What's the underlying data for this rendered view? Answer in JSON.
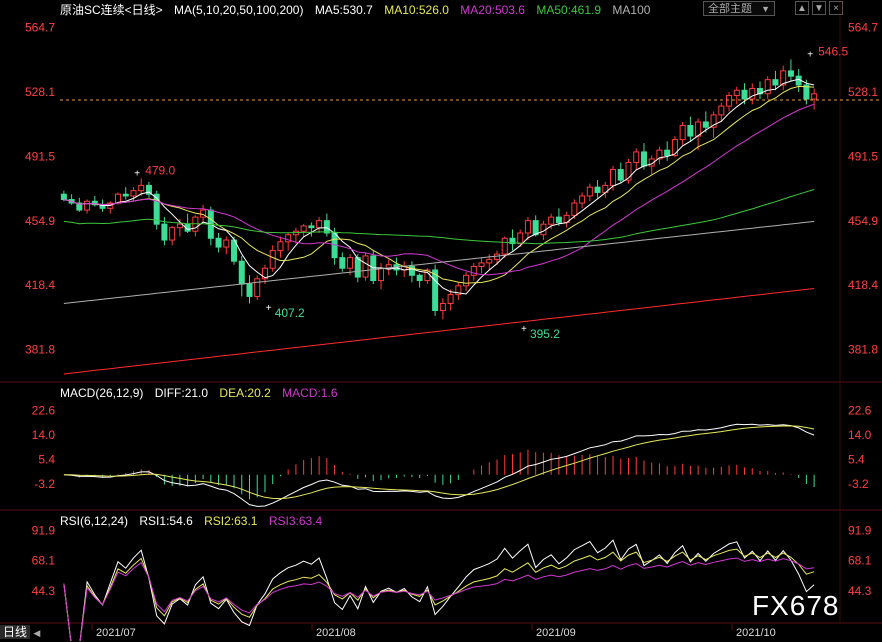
{
  "header": {
    "instrument": "原油SC连续",
    "period": "<日线>",
    "ma_params": "MA(5,10,20,50,100,200)",
    "ma5": "MA5:530.7",
    "ma10": "MA10:526.0",
    "ma20": "MA20:503.6",
    "ma50": "MA50:461.9",
    "ma100": "MA100"
  },
  "controls": {
    "theme_select": "全部主题",
    "btn1": "▲",
    "btn2": "▼",
    "btn3": "×"
  },
  "macd_header": {
    "params": "MACD(26,12,9)",
    "diff": "DIFF:21.0",
    "dea": "DEA:20.2",
    "macd": "MACD:1.6"
  },
  "rsi_header": {
    "params": "RSI(6,12,24)",
    "rsi1": "RSI1:54.6",
    "rsi2": "RSI2:63.1",
    "rsi3": "RSI3:63.4"
  },
  "bottom_left": "日线",
  "watermark": "FX678",
  "colors": {
    "up": "#ff3b3b",
    "down": "#3ddc97",
    "ma5": "#ffffff",
    "ma10": "#e8e85a",
    "ma20": "#d238d2",
    "ma50": "#3cc83c",
    "ma100": "#b0b0b0",
    "ma200": "#ff2a2a",
    "axis": "#ff4040"
  },
  "chart_data": [
    {
      "type": "candlestick",
      "y_ticks": [
        "564.7",
        "528.1",
        "491.5",
        "454.9",
        "418.4",
        "381.8"
      ],
      "x_ticks": [
        "2021/07",
        "2021/08",
        "2021/09",
        "2021/10"
      ],
      "ylim": [
        364,
        570
      ],
      "last_price_line": 523.5,
      "annotations": [
        {
          "label": "479.0",
          "index": 10,
          "value": 479.0,
          "kind": "high"
        },
        {
          "label": "407.2",
          "index": 27,
          "value": 407.2,
          "kind": "low"
        },
        {
          "label": "395.2",
          "index": 60,
          "value": 395.2,
          "kind": "low"
        },
        {
          "label": "546.5",
          "index": 97,
          "value": 546.5,
          "kind": "high"
        }
      ],
      "ohlc": [
        [
          470,
          472,
          466,
          467
        ],
        [
          467,
          470,
          464,
          465
        ],
        [
          465,
          468,
          460,
          461
        ],
        [
          461,
          467,
          459,
          466
        ],
        [
          466,
          469,
          463,
          464
        ],
        [
          464,
          467,
          460,
          462
        ],
        [
          462,
          466,
          459,
          465
        ],
        [
          465,
          471,
          464,
          470
        ],
        [
          470,
          474,
          467,
          469
        ],
        [
          469,
          474,
          466,
          472
        ],
        [
          472,
          479,
          469,
          475
        ],
        [
          475,
          477,
          468,
          470
        ],
        [
          470,
          472,
          450,
          453
        ],
        [
          453,
          457,
          441,
          444
        ],
        [
          444,
          452,
          441,
          451
        ],
        [
          451,
          456,
          446,
          453
        ],
        [
          453,
          459,
          448,
          449
        ],
        [
          449,
          458,
          446,
          457
        ],
        [
          457,
          464,
          453,
          461
        ],
        [
          461,
          463,
          441,
          445
        ],
        [
          445,
          448,
          437,
          440
        ],
        [
          440,
          446,
          436,
          444
        ],
        [
          444,
          446,
          430,
          432
        ],
        [
          432,
          435,
          412,
          419
        ],
        [
          419,
          424,
          408,
          412
        ],
        [
          412,
          424,
          410,
          422
        ],
        [
          422,
          430,
          419,
          428
        ],
        [
          428,
          441,
          426,
          438
        ],
        [
          438,
          446,
          434,
          443
        ],
        [
          443,
          448,
          438,
          447
        ],
        [
          447,
          451,
          442,
          449
        ],
        [
          449,
          453,
          446,
          452
        ],
        [
          452,
          454,
          446,
          451
        ],
        [
          451,
          457,
          448,
          455
        ],
        [
          455,
          459,
          446,
          448
        ],
        [
          448,
          451,
          430,
          434
        ],
        [
          434,
          437,
          426,
          428
        ],
        [
          428,
          436,
          424,
          434
        ],
        [
          434,
          436,
          420,
          423
        ],
        [
          423,
          437,
          421,
          435
        ],
        [
          435,
          438,
          419,
          421
        ],
        [
          421,
          431,
          416,
          428
        ],
        [
          428,
          433,
          424,
          430
        ],
        [
          430,
          434,
          424,
          427
        ],
        [
          427,
          432,
          423,
          429
        ],
        [
          429,
          432,
          420,
          424
        ],
        [
          424,
          425,
          417,
          421
        ],
        [
          421,
          428,
          419,
          427
        ],
        [
          427,
          430,
          401,
          404
        ],
        [
          404,
          411,
          399,
          408
        ],
        [
          408,
          416,
          404,
          413
        ],
        [
          413,
          420,
          410,
          418
        ],
        [
          418,
          426,
          415,
          424
        ],
        [
          424,
          431,
          421,
          429
        ],
        [
          429,
          434,
          425,
          431
        ],
        [
          431,
          436,
          427,
          433
        ],
        [
          433,
          438,
          430,
          436
        ],
        [
          436,
          446,
          434,
          445
        ],
        [
          445,
          450,
          438,
          442
        ],
        [
          442,
          450,
          440,
          448
        ],
        [
          448,
          457,
          444,
          455
        ],
        [
          455,
          458,
          446,
          447
        ],
        [
          447,
          455,
          444,
          453
        ],
        [
          453,
          459,
          450,
          457
        ],
        [
          457,
          462,
          452,
          454
        ],
        [
          454,
          460,
          451,
          458
        ],
        [
          458,
          467,
          456,
          465
        ],
        [
          465,
          471,
          462,
          469
        ],
        [
          469,
          476,
          466,
          474
        ],
        [
          474,
          478,
          468,
          471
        ],
        [
          471,
          477,
          468,
          475
        ],
        [
          475,
          486,
          472,
          484
        ],
        [
          484,
          488,
          476,
          478
        ],
        [
          478,
          490,
          476,
          488
        ],
        [
          488,
          496,
          484,
          494
        ],
        [
          494,
          499,
          484,
          486
        ],
        [
          486,
          492,
          481,
          490
        ],
        [
          490,
          497,
          487,
          495
        ],
        [
          495,
          500,
          489,
          492
        ],
        [
          492,
          503,
          491,
          501
        ],
        [
          501,
          511,
          498,
          509
        ],
        [
          509,
          514,
          500,
          503
        ],
        [
          503,
          513,
          495,
          511
        ],
        [
          511,
          517,
          505,
          508
        ],
        [
          508,
          517,
          502,
          515
        ],
        [
          515,
          522,
          511,
          520
        ],
        [
          520,
          528,
          517,
          526
        ],
        [
          526,
          531,
          521,
          529
        ],
        [
          529,
          533,
          521,
          524
        ],
        [
          524,
          533,
          521,
          530
        ],
        [
          530,
          534,
          524,
          527
        ],
        [
          527,
          537,
          524,
          535
        ],
        [
          535,
          540,
          529,
          532
        ],
        [
          532,
          543,
          529,
          540
        ],
        [
          540,
          546.5,
          534,
          537
        ],
        [
          537,
          541,
          528,
          532
        ],
        [
          532,
          535,
          521,
          524
        ],
        [
          524,
          530,
          518,
          527
        ]
      ],
      "ma_values": {
        "ma5": 530.7,
        "ma10": 526.0,
        "ma20": 503.6,
        "ma50": 461.9
      }
    },
    {
      "type": "line+bar",
      "name": "MACD",
      "y_ticks": [
        "22.6",
        "14.0",
        "5.4",
        "-3.2"
      ],
      "ylim": [
        -11,
        27
      ]
    },
    {
      "type": "line",
      "name": "RSI",
      "y_ticks": [
        "91.9",
        "68.1",
        "44.3"
      ],
      "ylim": [
        20,
        100
      ]
    }
  ]
}
